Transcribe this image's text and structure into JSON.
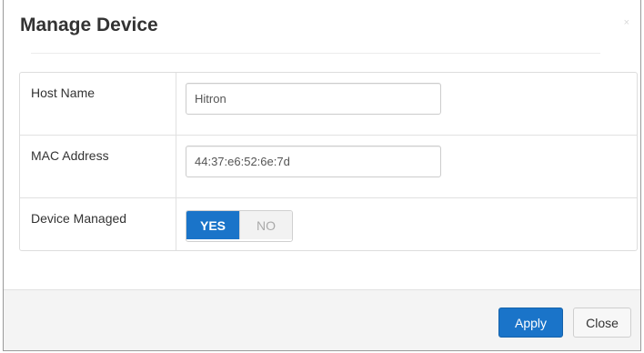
{
  "dialog": {
    "title": "Manage Device",
    "close_glyph": "×"
  },
  "form": {
    "host_name": {
      "label": "Host Name",
      "value": "Hitron"
    },
    "mac_address": {
      "label": "MAC Address",
      "value": "44:37:e6:52:6e:7d"
    },
    "device_managed": {
      "label": "Device Managed",
      "options": [
        "YES",
        "NO"
      ],
      "selected": "YES"
    }
  },
  "footer": {
    "apply_label": "Apply",
    "close_label": "Close"
  },
  "colors": {
    "accent": "#1a74c9",
    "footer_bg": "#f4f4f4"
  }
}
